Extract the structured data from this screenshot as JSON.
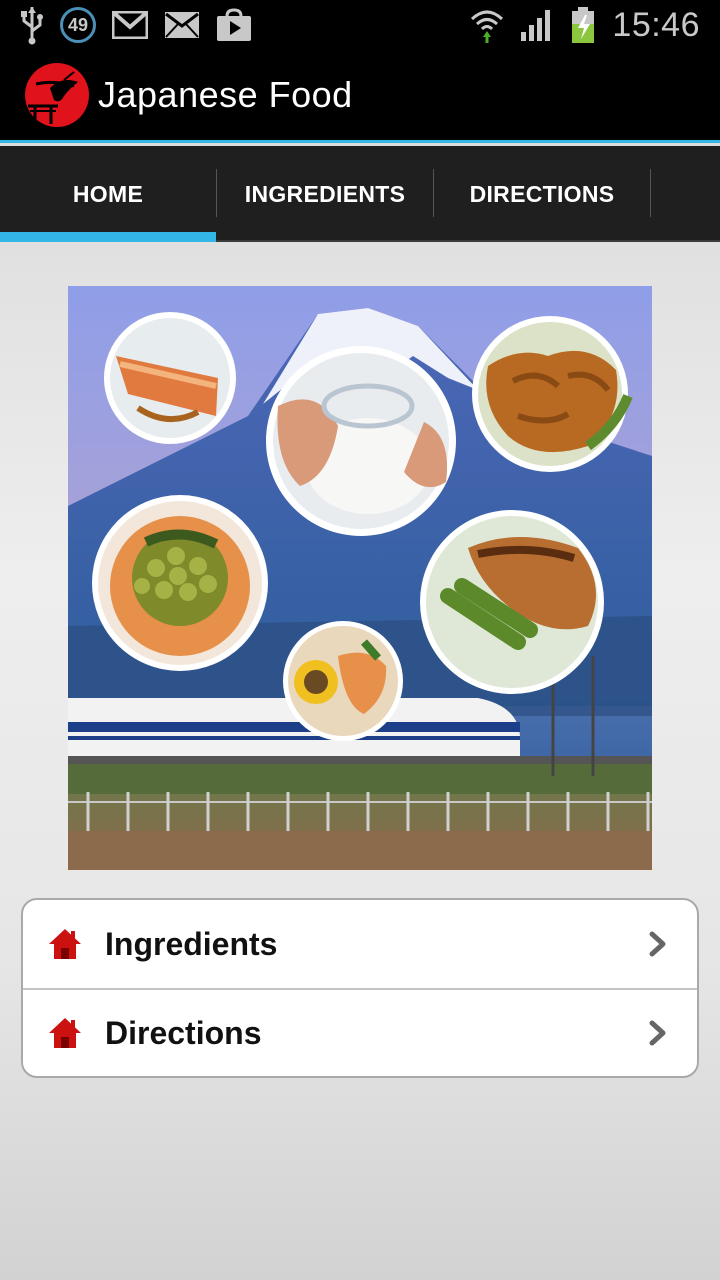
{
  "status_bar": {
    "notification_count": "49",
    "clock": "15:46",
    "icons": [
      "usb-icon",
      "update-badge-icon",
      "gmail-icon",
      "email-icon",
      "play-store-icon",
      "wifi-icon",
      "signal-icon",
      "battery-charging-icon"
    ]
  },
  "action_bar": {
    "title": "Japanese Food",
    "logo_icon": "torii-crane-logo"
  },
  "tabs": [
    {
      "label": "HOME",
      "selected": true
    },
    {
      "label": "INGREDIENTS",
      "selected": false
    },
    {
      "label": "DIRECTIONS",
      "selected": false
    }
  ],
  "menu": {
    "items": [
      {
        "label": "Ingredients",
        "icon": "home-icon"
      },
      {
        "label": "Directions",
        "icon": "home-icon"
      }
    ]
  },
  "colors": {
    "accent": "#33b5e5",
    "action_bar": "#000000",
    "tab_bar": "#1f1f1f",
    "home_icon": "#cc1111",
    "logo_red": "#e0121b"
  }
}
